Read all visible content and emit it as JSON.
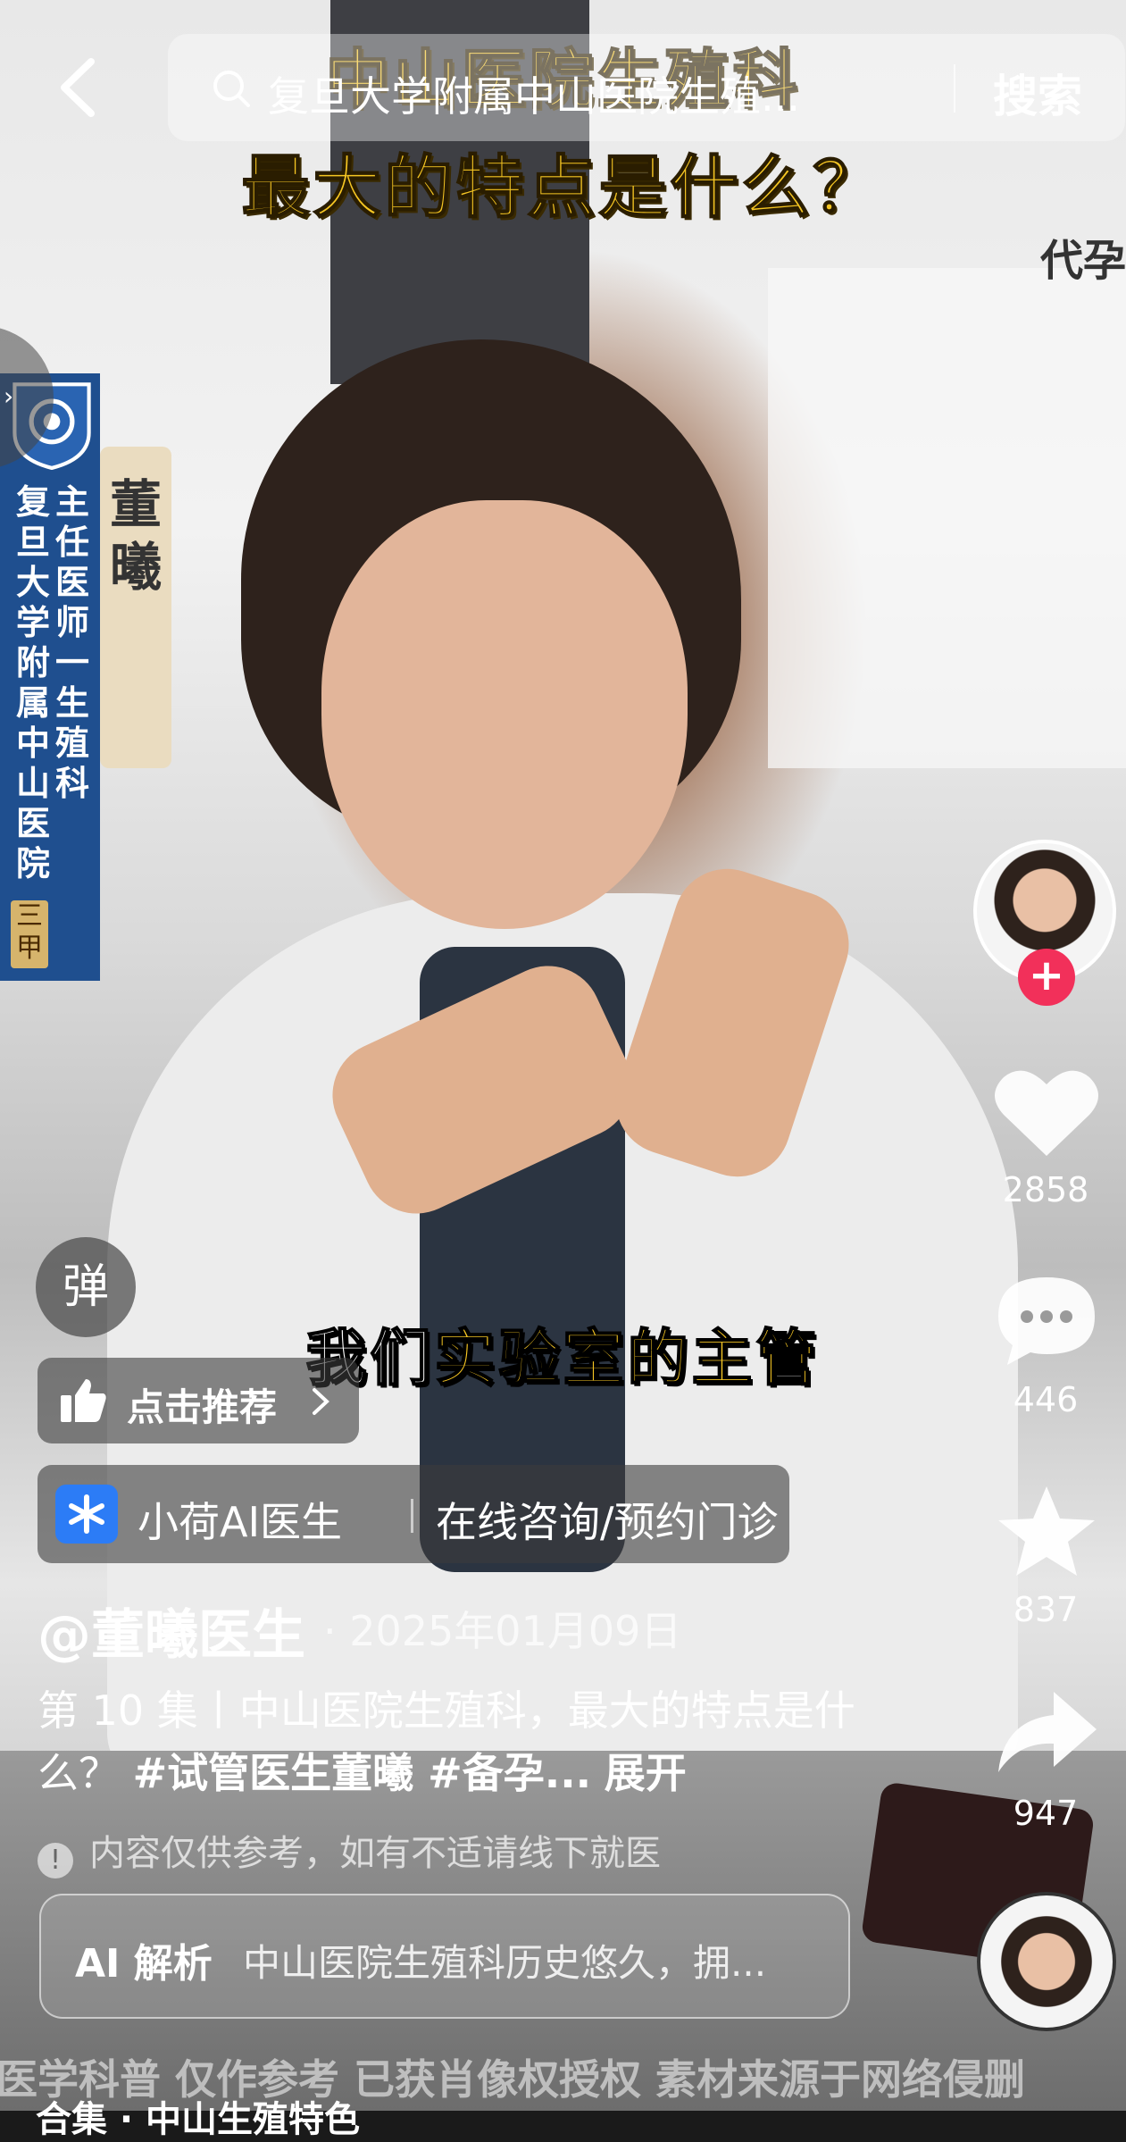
{
  "overlay_titles": [
    "中山医院生殖科",
    "最大的特点是什么？"
  ],
  "search": {
    "query": "复旦大学附属中山医院生殖...",
    "button": "搜索"
  },
  "side_tag": "代孕",
  "hospital_banner": {
    "col_institution": "复旦大学附属中山医院",
    "col_title": "主任医师一生殖科",
    "name": "董曦",
    "grade": "三甲"
  },
  "subtitle_caption": {
    "white": "我们",
    "yellow": "实验室的主管"
  },
  "danmu_label": "弹",
  "recommend_label": "点击推荐",
  "ai_doctor": {
    "name": "小荷AI医生",
    "action": "在线咨询/预约门诊"
  },
  "author": "@董曦医生",
  "publish_date": "· 2025年01月09日",
  "description": {
    "text": "第 10 集丨中山医院生殖科，最大的特点是什么？",
    "tags": "#试管医生董曦 #备孕...",
    "expand": "展开"
  },
  "disclaimer": "内容仅供参考，如有不适请线下就医",
  "ai_analysis": {
    "label": "AI 解析",
    "text": "中山医院生殖科历史悠久，拥..."
  },
  "watermark": "医学科普 仅作参考 已获肖像权授权 素材来源于网络侵删",
  "collection": "合集 · 中山生殖特色",
  "actions": {
    "likes": "2858",
    "comments": "446",
    "favorites": "837",
    "shares": "947"
  },
  "colors": {
    "follow": "#f2305a",
    "title_yellow": "#f6c623",
    "ai_logo": "#2c7cf6",
    "hospital_blue": "#1f4f8f"
  }
}
